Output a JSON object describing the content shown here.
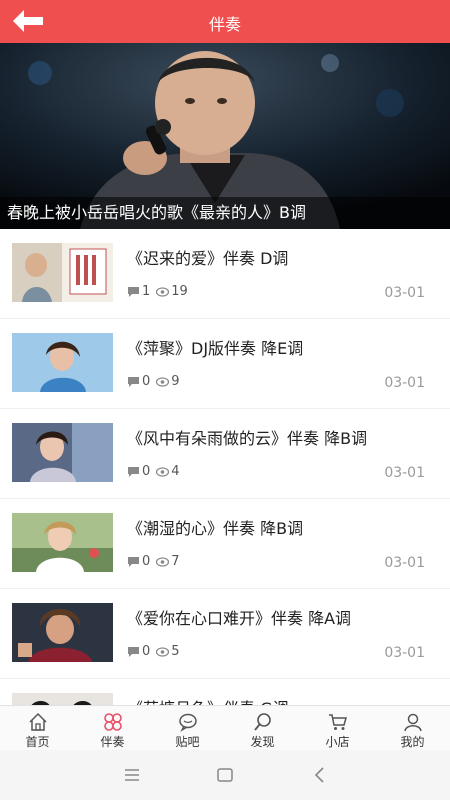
{
  "header": {
    "title": "伴奏",
    "back_icon": "back-arrow-icon"
  },
  "banner": {
    "caption": "春晚上被小岳岳唱火的歌《最亲的人》B调"
  },
  "items": [
    {
      "title": "《迟来的爱》伴奏 D调",
      "comments": "1",
      "views": "19",
      "date": "03-01"
    },
    {
      "title": "《萍聚》DJ版伴奏 降E调",
      "comments": "0",
      "views": "9",
      "date": "03-01"
    },
    {
      "title": "《风中有朵雨做的云》伴奏 降B调",
      "comments": "0",
      "views": "4",
      "date": "03-01"
    },
    {
      "title": "《潮湿的心》伴奏 降B调",
      "comments": "0",
      "views": "7",
      "date": "03-01"
    },
    {
      "title": "《爱你在心口难开》伴奏 降A调",
      "comments": "0",
      "views": "5",
      "date": "03-01"
    },
    {
      "title": "《荷塘月色》伴奏 G调",
      "comments": "",
      "views": "",
      "date": ""
    }
  ],
  "tabs": [
    {
      "label": "首页",
      "icon": "home-icon"
    },
    {
      "label": "伴奏",
      "icon": "accompaniment-icon"
    },
    {
      "label": "贴吧",
      "icon": "chat-icon"
    },
    {
      "label": "发现",
      "icon": "search-icon"
    },
    {
      "label": "小店",
      "icon": "cart-icon"
    },
    {
      "label": "我的",
      "icon": "user-icon"
    }
  ],
  "colors": {
    "accent": "#f04f4f",
    "date": "#9a9a9a",
    "active_tab_icon": "#e8506a"
  }
}
